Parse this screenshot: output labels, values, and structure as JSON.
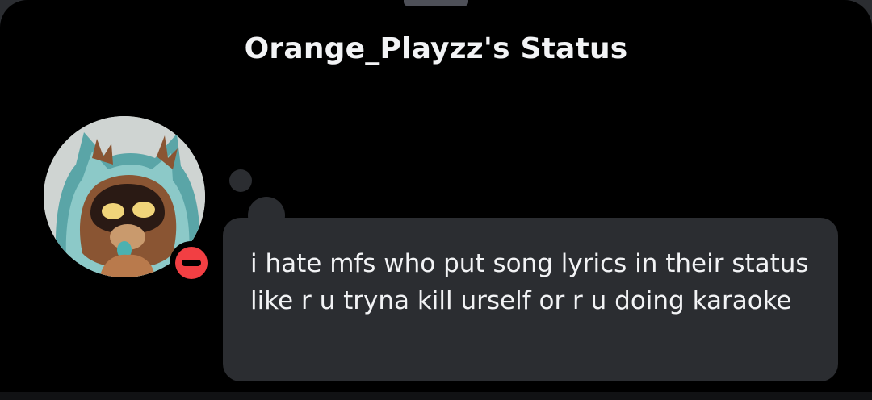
{
  "sheet": {
    "title": "Orange_Playzz's Status"
  },
  "user": {
    "avatar_icon": "user-avatar",
    "presence": "do-not-disturb",
    "presence_color": "#f23f43"
  },
  "status": {
    "text": "i hate mfs who put song lyrics in their status like r u tryna kill urself or r u doing karaoke"
  },
  "colors": {
    "background": "#000000",
    "bubble": "#2b2d31",
    "text": "#f2f3f5"
  }
}
